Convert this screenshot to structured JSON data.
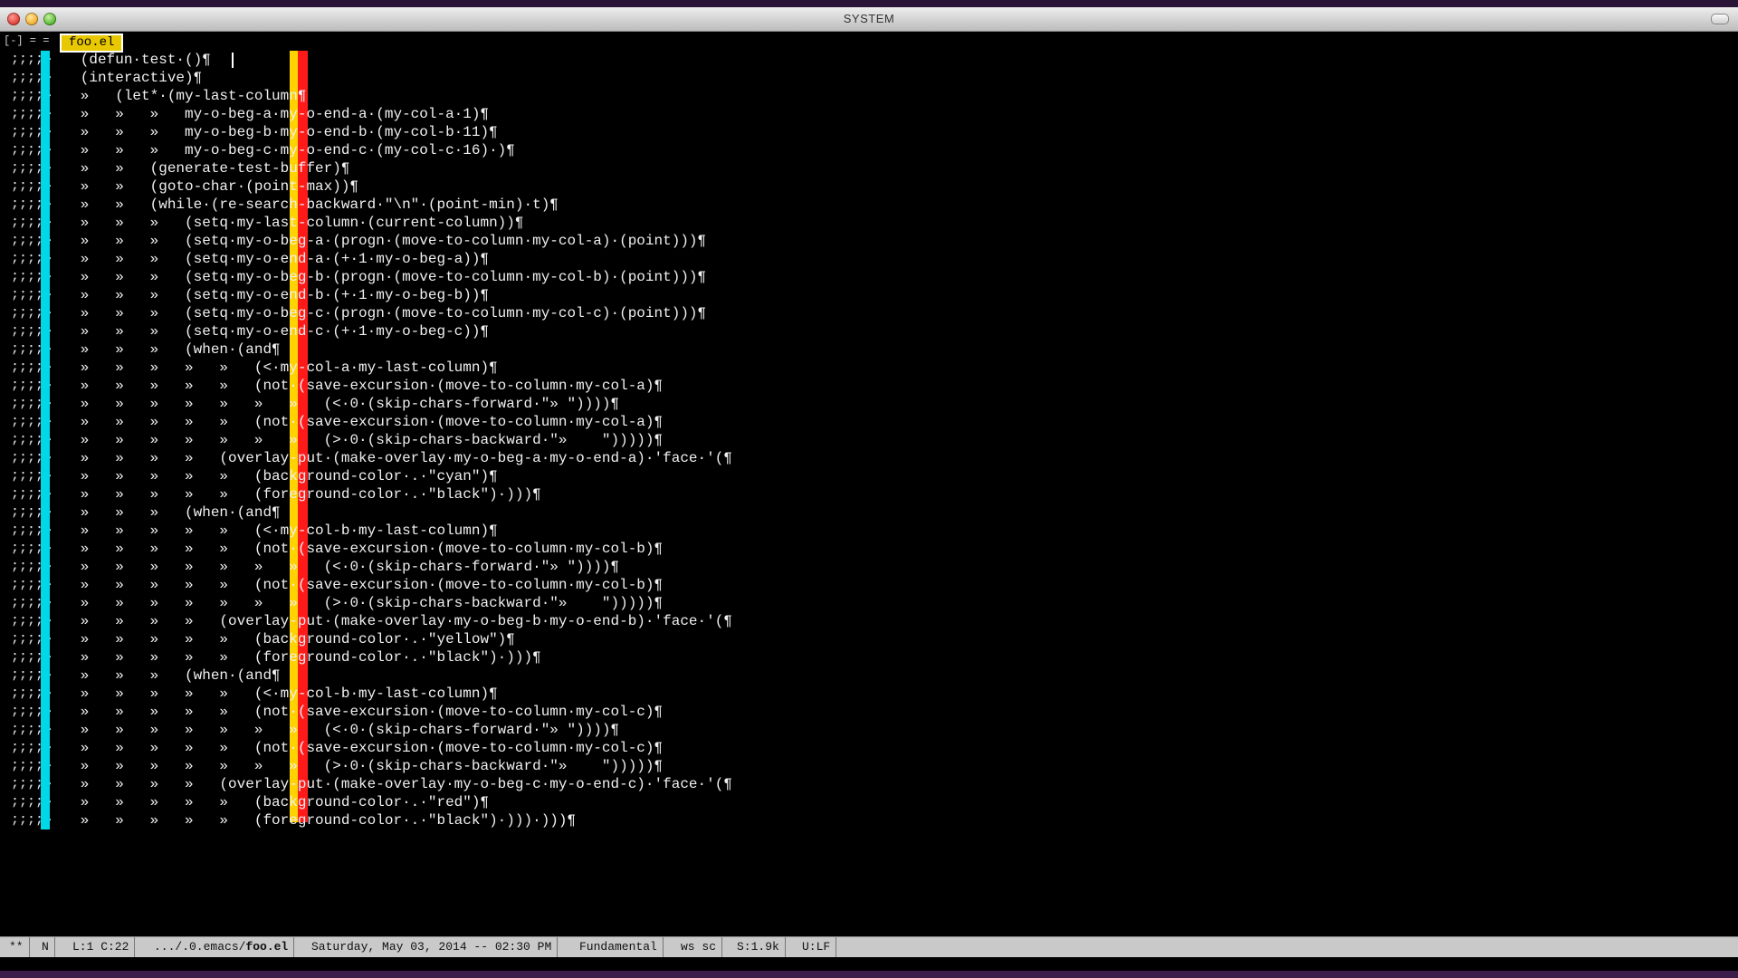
{
  "window": {
    "title": "SYSTEM"
  },
  "tabs": {
    "prefix": "[-] = =",
    "active": "foo.el"
  },
  "gutter_text": ";;;;»",
  "code_lines": [
    "   (defun·test·()¶",
    "   (interactive)¶",
    "   »   (let*·(my-last-column¶",
    "   »   »   »   my-o-beg-a·my-o-end-a·(my-col-a·1)¶",
    "   »   »   »   my-o-beg-b·my-o-end-b·(my-col-b·11)¶",
    "   »   »   »   my-o-beg-c·my-o-end-c·(my-col-c·16)·)¶",
    "   »   »   (generate-test-buffer)¶",
    "   »   »   (goto-char·(point-max))¶",
    "   »   »   (while·(re-search-backward·\"\\n\"·(point-min)·t)¶",
    "   »   »   »   (setq·my-last-column·(current-column))¶",
    "   »   »   »   (setq·my-o-beg-a·(progn·(move-to-column·my-col-a)·(point)))¶",
    "   »   »   »   (setq·my-o-end-a·(+·1·my-o-beg-a))¶",
    "   »   »   »   (setq·my-o-beg-b·(progn·(move-to-column·my-col-b)·(point)))¶",
    "   »   »   »   (setq·my-o-end-b·(+·1·my-o-beg-b))¶",
    "   »   »   »   (setq·my-o-beg-c·(progn·(move-to-column·my-col-c)·(point)))¶",
    "   »   »   »   (setq·my-o-end-c·(+·1·my-o-beg-c))¶",
    "   »   »   »   (when·(and¶",
    "   »   »   »   »   »   (<·my-col-a·my-last-column)¶",
    "   »   »   »   »   »   (not·(save-excursion·(move-to-column·my-col-a)¶",
    "   »   »   »   »   »   »   »   (<·0·(skip-chars-forward·\"» \"))))¶",
    "   »   »   »   »   »   (not·(save-excursion·(move-to-column·my-col-a)¶",
    "   »   »   »   »   »   »   »   (>·0·(skip-chars-backward·\"»    \")))))¶",
    "   »   »   »   »   (overlay-put·(make-overlay·my-o-beg-a·my-o-end-a)·'face·'(¶",
    "   »   »   »   »   »   (background-color·.·\"cyan\")¶",
    "   »   »   »   »   »   (foreground-color·.·\"black\")·)))¶",
    "   »   »   »   (when·(and¶",
    "   »   »   »   »   »   (<·my-col-b·my-last-column)¶",
    "   »   »   »   »   »   (not·(save-excursion·(move-to-column·my-col-b)¶",
    "   »   »   »   »   »   »   »   (<·0·(skip-chars-forward·\"» \"))))¶",
    "   »   »   »   »   »   (not·(save-excursion·(move-to-column·my-col-b)¶",
    "   »   »   »   »   »   »   »   (>·0·(skip-chars-backward·\"»    \")))))¶",
    "   »   »   »   »   (overlay-put·(make-overlay·my-o-beg-b·my-o-end-b)·'face·'(¶",
    "   »   »   »   »   »   (background-color·.·\"yellow\")¶",
    "   »   »   »   »   »   (foreground-color·.·\"black\")·)))¶",
    "   »   »   »   (when·(and¶",
    "   »   »   »   »   »   (<·my-col-b·my-last-column)¶",
    "   »   »   »   »   »   (not·(save-excursion·(move-to-column·my-col-c)¶",
    "   »   »   »   »   »   »   »   (<·0·(skip-chars-forward·\"» \"))))¶",
    "   »   »   »   »   »   (not·(save-excursion·(move-to-column·my-col-c)¶",
    "   »   »   »   »   »   »   »   (>·0·(skip-chars-backward·\"»    \")))))¶",
    "   »   »   »   »   (overlay-put·(make-overlay·my-o-beg-c·my-o-end-c)·'face·'(¶",
    "   »   »   »   »   »   (background-color·.·\"red\")¶",
    "   »   »   »   »   »   (foreground-color·.·\"black\")·)))·)))¶"
  ],
  "modeline": {
    "modified": "**",
    "mode_flag": "N",
    "position": "L:1 C:22",
    "path_prefix": ".../.0.emacs/",
    "path_file": "foo.el",
    "datetime": "Saturday, May 03, 2014 -- 02:30 PM",
    "major_mode": "Fundamental",
    "minor_modes": "ws sc",
    "size": "S:1.9k",
    "encoding": "U:LF"
  },
  "colors": {
    "column_cyan": "#00d8e8",
    "column_yellow": "#ffd200",
    "column_red": "#ff1a1a",
    "tab_active_bg": "#e8c800"
  }
}
